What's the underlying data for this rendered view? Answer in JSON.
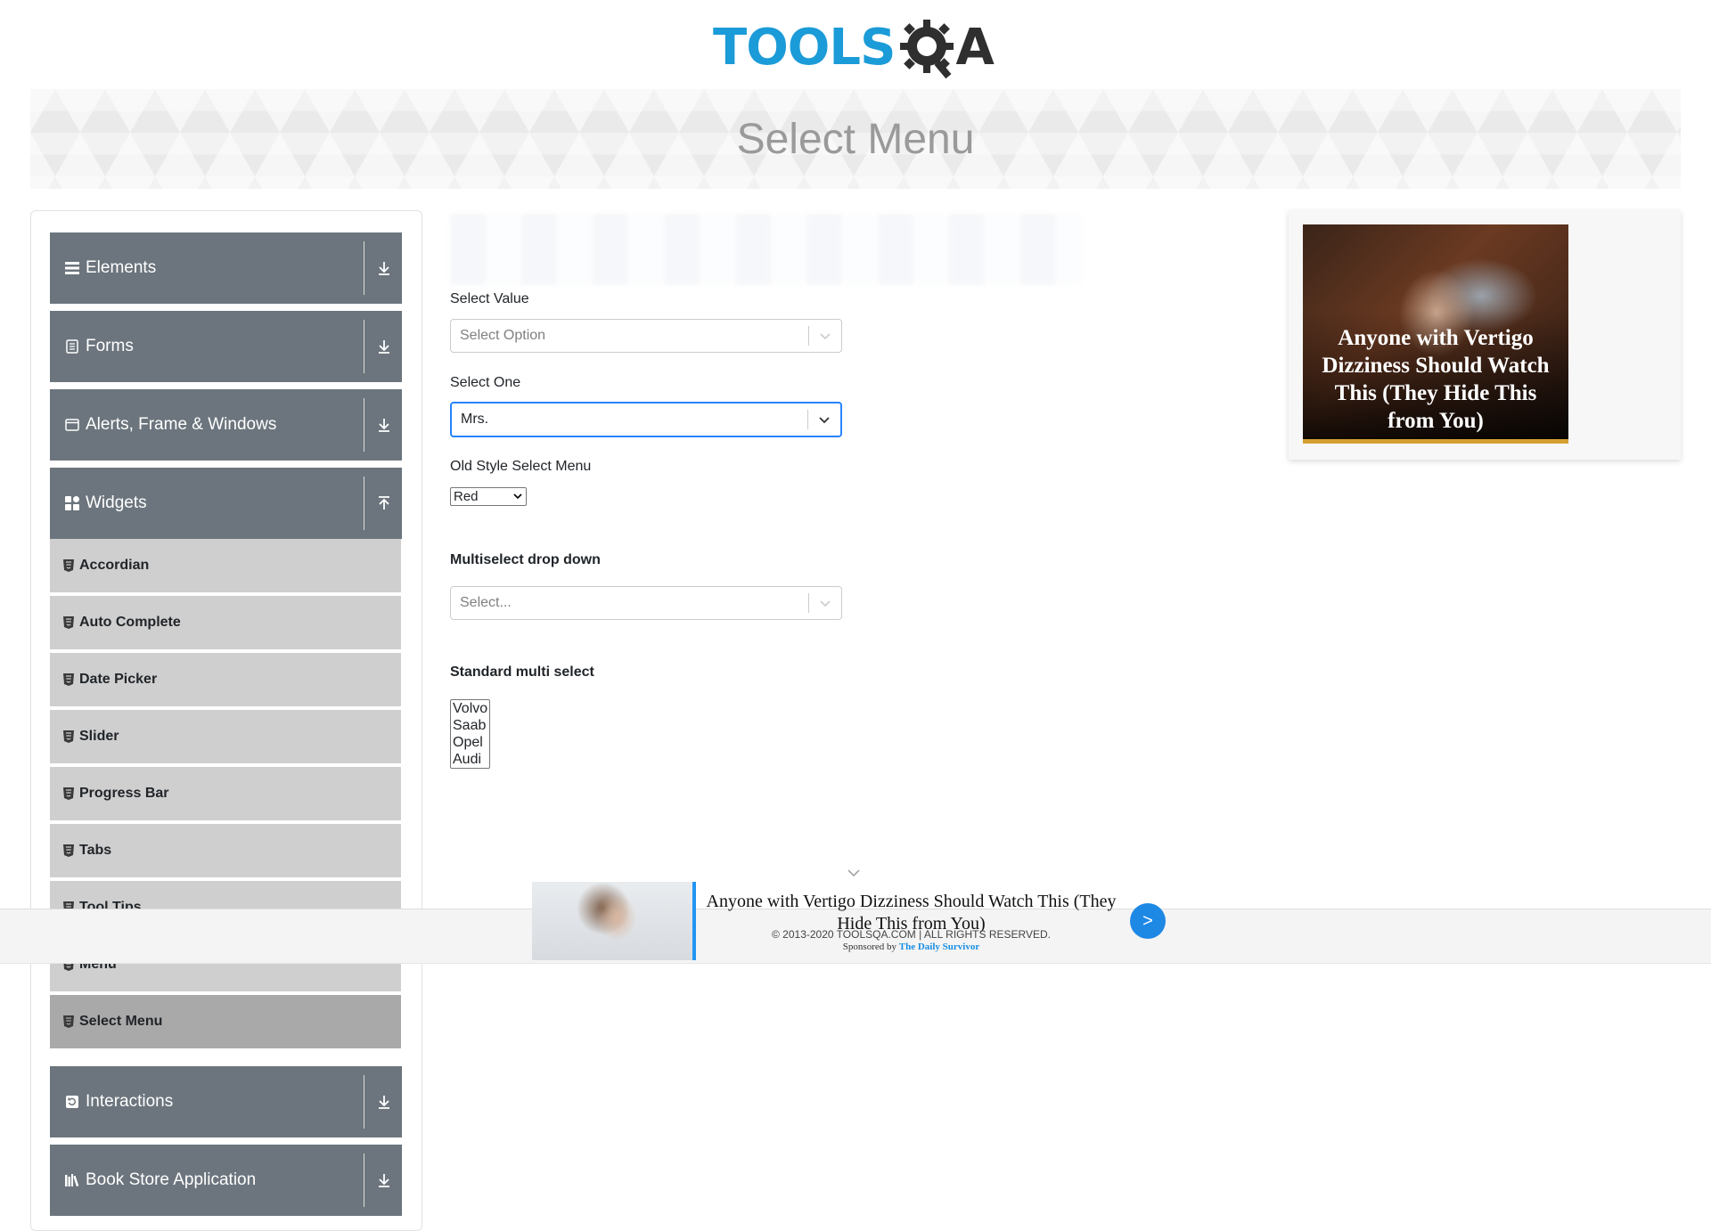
{
  "header": {
    "logo_tools": "TOOLS",
    "logo_qa": "QA",
    "page_title": "Select Menu"
  },
  "sidebar": {
    "groups": [
      {
        "label": "Elements",
        "icon": "hamburger-icon",
        "state": "collapsed"
      },
      {
        "label": "Forms",
        "icon": "document-icon",
        "state": "collapsed"
      },
      {
        "label": "Alerts, Frame & Windows",
        "icon": "window-icon",
        "state": "collapsed"
      },
      {
        "label": "Widgets",
        "icon": "widgets-icon",
        "state": "expanded"
      },
      {
        "label": "Interactions",
        "icon": "interactions-icon",
        "state": "collapsed"
      },
      {
        "label": "Book Store Application",
        "icon": "books-icon",
        "state": "collapsed"
      }
    ],
    "widget_items": [
      "Accordian",
      "Auto Complete",
      "Date Picker",
      "Slider",
      "Progress Bar",
      "Tabs",
      "Tool Tips",
      "Menu",
      "Select Menu"
    ],
    "active_item": "Select Menu"
  },
  "form": {
    "select_value": {
      "label": "Select Value",
      "placeholder": "Select Option"
    },
    "select_one": {
      "label": "Select One",
      "value": "Mrs."
    },
    "old_style": {
      "label": "Old Style Select Menu",
      "value": "Red"
    },
    "multiselect": {
      "label": "Multiselect drop down",
      "placeholder": "Select..."
    },
    "standard_multi": {
      "label": "Standard multi select",
      "options": [
        "Volvo",
        "Saab",
        "Opel",
        "Audi"
      ]
    }
  },
  "ad": {
    "title": "Anyone with Vertigo Dizziness Should Watch This (They Hide This from You)"
  },
  "sticky_ad": {
    "text": "Anyone with Vertigo Dizziness Should Watch This (They Hide This from You)",
    "sponsor_prefix": "Sponsored by",
    "sponsor_name": "The Daily Survivor",
    "button": ">"
  },
  "footer": {
    "copyright": "© 2013-2020 TOOLSQA.COM | ALL RIGHTS RESERVED."
  },
  "colors": {
    "sidebar_group_bg": "#6c757d",
    "sidebar_item_bg": "#cfcfcf",
    "sidebar_active_bg": "#a9a9a9",
    "logo_blue": "#1b9bd7",
    "focus_blue": "#2684ff",
    "accent_blue": "#1e88e5"
  }
}
